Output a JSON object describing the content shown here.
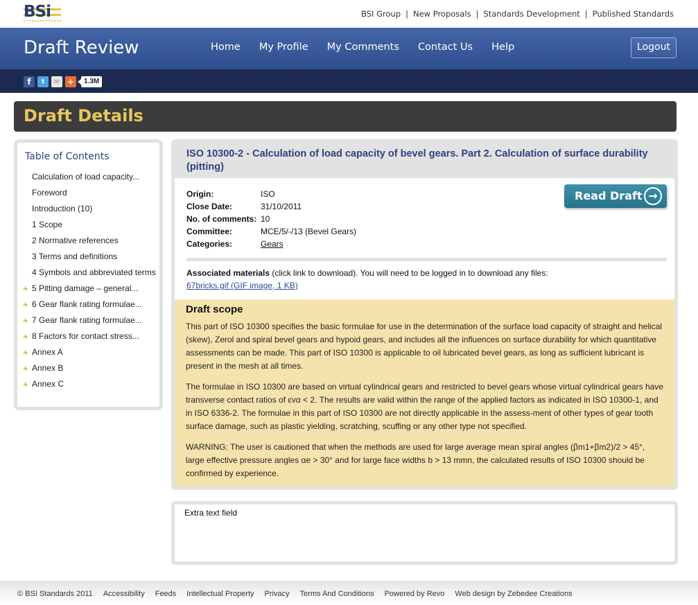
{
  "brand": {
    "logo_text": "BSi",
    "colors": {
      "navy": "#1f3d7a",
      "gold": "#e8c33b",
      "header_blue": "#3a5a9a",
      "accent_teal": "#2f80a0",
      "scope_bg": "#f5e3ae"
    }
  },
  "top_links": [
    "BSI Group",
    "New Proposals",
    "Standards Development",
    "Published Standards"
  ],
  "header": {
    "site_title": "Draft Review",
    "nav": [
      "Home",
      "My Profile",
      "My Comments",
      "Contact Us",
      "Help"
    ],
    "logout_label": "Logout"
  },
  "social": {
    "icons": [
      "facebook-icon",
      "twitter-icon",
      "email-icon",
      "addthis-plus-icon"
    ],
    "share_count": "1.3M"
  },
  "page_title": "Draft Details",
  "toc": {
    "heading": "Table of Contents",
    "items": [
      {
        "label": "Calculation of load capacity...",
        "expandable": false
      },
      {
        "label": "Foreword",
        "expandable": false
      },
      {
        "label": "Introduction (10)",
        "expandable": false
      },
      {
        "label": "1 Scope",
        "expandable": false
      },
      {
        "label": "2 Normative references",
        "expandable": false
      },
      {
        "label": "3 Terms and definitions",
        "expandable": false
      },
      {
        "label": "4 Symbols and abbreviated terms",
        "expandable": false
      },
      {
        "label": "5 Pitting damage – general...",
        "expandable": true
      },
      {
        "label": "6 Gear flank rating formulae...",
        "expandable": true
      },
      {
        "label": "7 Gear flank rating formulae...",
        "expandable": true
      },
      {
        "label": "8 Factors for contact stress...",
        "expandable": true
      },
      {
        "label": "Annex A",
        "expandable": true
      },
      {
        "label": "Annex B",
        "expandable": true
      },
      {
        "label": "Annex C",
        "expandable": true
      }
    ],
    "expand_glyph": "+"
  },
  "draft": {
    "title": "ISO 10300-2 - Calculation of load capacity of bevel gears. Part 2. Calculation of surface durability (pitting)",
    "read_draft_label": "Read Draft",
    "read_draft_arrow": "→",
    "meta": [
      {
        "key": "Origin:",
        "value": "ISO"
      },
      {
        "key": "Close Date:",
        "value": "31/10/2011"
      },
      {
        "key": "No. of comments:",
        "value": "10"
      },
      {
        "key": "Committee:",
        "value": "MCE/5/-/13 (Bevel Gears)"
      },
      {
        "key": "Categories:",
        "value": "Gears",
        "link": true
      }
    ],
    "associated": {
      "bold": "Associated materials",
      "rest": " (click link to download). You will need to be logged in to download any files:",
      "file_link": "67bricks.gif (GIF image, 1 KB)"
    },
    "scope": {
      "heading": "Draft scope",
      "paragraphs": [
        "This part of ISO 10300 specifies the basic formulae for use in the determination of the surface load capacity of straight and helical (skew), Zerol and spiral bevel gears and hypoid gears, and includes all the influences on surface durability for which quantitative assessments can be made. This part of ISO 10300 is applicable to oil lubricated bevel gears, as long as sufficient lubricant is present in the mesh at all times.",
        "The formulae in ISO 10300 are based on virtual cylindrical gears and restricted to bevel gears whose virtual cylindrical gears have transverse contact ratios of εvα < 2. The results are valid within the range of the applied factors as indicated in ISO 10300-1, and in ISO 6336-2. The formulae in this part of ISO 10300 are not directly applicable in the assess-ment of other types of gear tooth surface damage, such as plastic yielding, scratching, scuffing or any other type not specified.",
        "WARNING: The user is cautioned that when the methods are used for large average mean spiral angles (βm1+βm2)/2 > 45°, large effective pressure angles αe > 30° and for large face widths b > 13 mmn, the calculated results of ISO 10300 should be confirmed by experience."
      ]
    }
  },
  "extra_field": {
    "label": "Extra text field"
  },
  "footer": {
    "copyright": "© BSI Standards 2011",
    "links": [
      "Accessibility",
      "Feeds",
      "Intellectual Property",
      "Privacy",
      "Terms And Conditions",
      "Powered by Revo",
      "Web design by Zebedee Creations"
    ]
  }
}
